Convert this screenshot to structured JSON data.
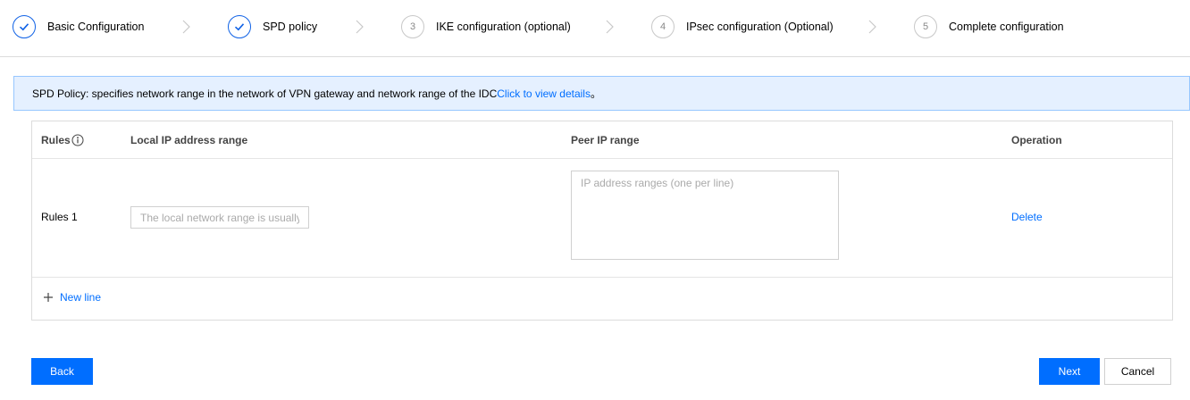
{
  "steps": [
    {
      "number": "1",
      "label": "Basic Configuration",
      "state": "done"
    },
    {
      "number": "2",
      "label": "SPD policy",
      "state": "done"
    },
    {
      "number": "3",
      "label": "IKE configuration (optional)",
      "state": "pending"
    },
    {
      "number": "4",
      "label": "IPsec configuration (Optional)",
      "state": "pending"
    },
    {
      "number": "5",
      "label": "Complete configuration",
      "state": "pending"
    }
  ],
  "info": {
    "text": "SPD Policy: specifies network range in the network of VPN gateway and network range of the IDC",
    "link": "Click to view details",
    "suffix": "。"
  },
  "table": {
    "headers": {
      "rules": "Rules",
      "local": "Local IP address range",
      "peer": "Peer IP range",
      "operation": "Operation"
    },
    "rows": [
      {
        "name": "Rules 1",
        "local_value": "",
        "local_placeholder": "The local network range is usually the VPC network range",
        "peer_value": "",
        "peer_placeholder": "IP address ranges (one per line)",
        "delete_label": "Delete"
      }
    ],
    "new_line_label": "New line"
  },
  "buttons": {
    "back": "Back",
    "next": "Next",
    "cancel": "Cancel"
  },
  "colors": {
    "accent": "#006eff",
    "info_bg": "#e5f0ff",
    "info_border": "#97c7ff"
  },
  "icons": {
    "done": "check-icon",
    "arrow": "chevron-right-icon",
    "help": "info-circle-icon",
    "add": "plus-icon"
  }
}
